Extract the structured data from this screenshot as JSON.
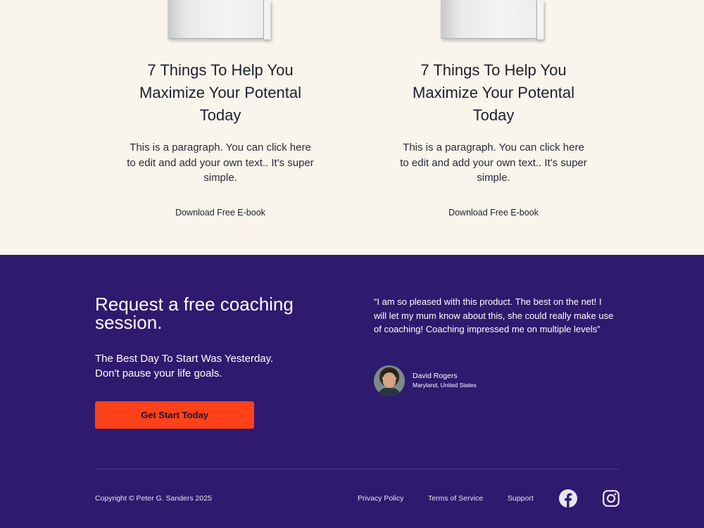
{
  "ebooks": [
    {
      "title": "7 Things To Help You Maximize Your Potental Today",
      "text": "This is a paragraph. You can click here to edit and add your own text.. It's super simple.",
      "link": "Download Free E-book"
    },
    {
      "title": "7 Things To Help You Maximize Your Potental Today",
      "text": "This is a paragraph. You can click here to edit and add your own text.. It's super simple.",
      "link": "Download Free E-book"
    }
  ],
  "cta": {
    "title": "Request a free coaching session.",
    "subtitle_line1": "The Best Day To Start Was Yesterday.",
    "subtitle_line2": "Don't pause your life goals.",
    "button": "Get Start Today"
  },
  "testimonial": {
    "quote": "“I am so pleased with this product. The best on the net! I will let my mum know about this, she could really make use of coaching! Coaching impressed me on multiple levels”",
    "name": "David Rogers",
    "location": "Maryland, United States"
  },
  "footer": {
    "copyright": "Copyright © Peter G. Sanders 2025",
    "links": [
      "Privacy Policy",
      "Terms of Service",
      "Support"
    ],
    "social_icons": [
      "facebook-icon",
      "instagram-icon"
    ]
  },
  "colors": {
    "page_background": "#f9f5ec",
    "dark_background": "#2e1a6e",
    "button": "#ff4119",
    "social_icon": "#e9e4f6"
  }
}
